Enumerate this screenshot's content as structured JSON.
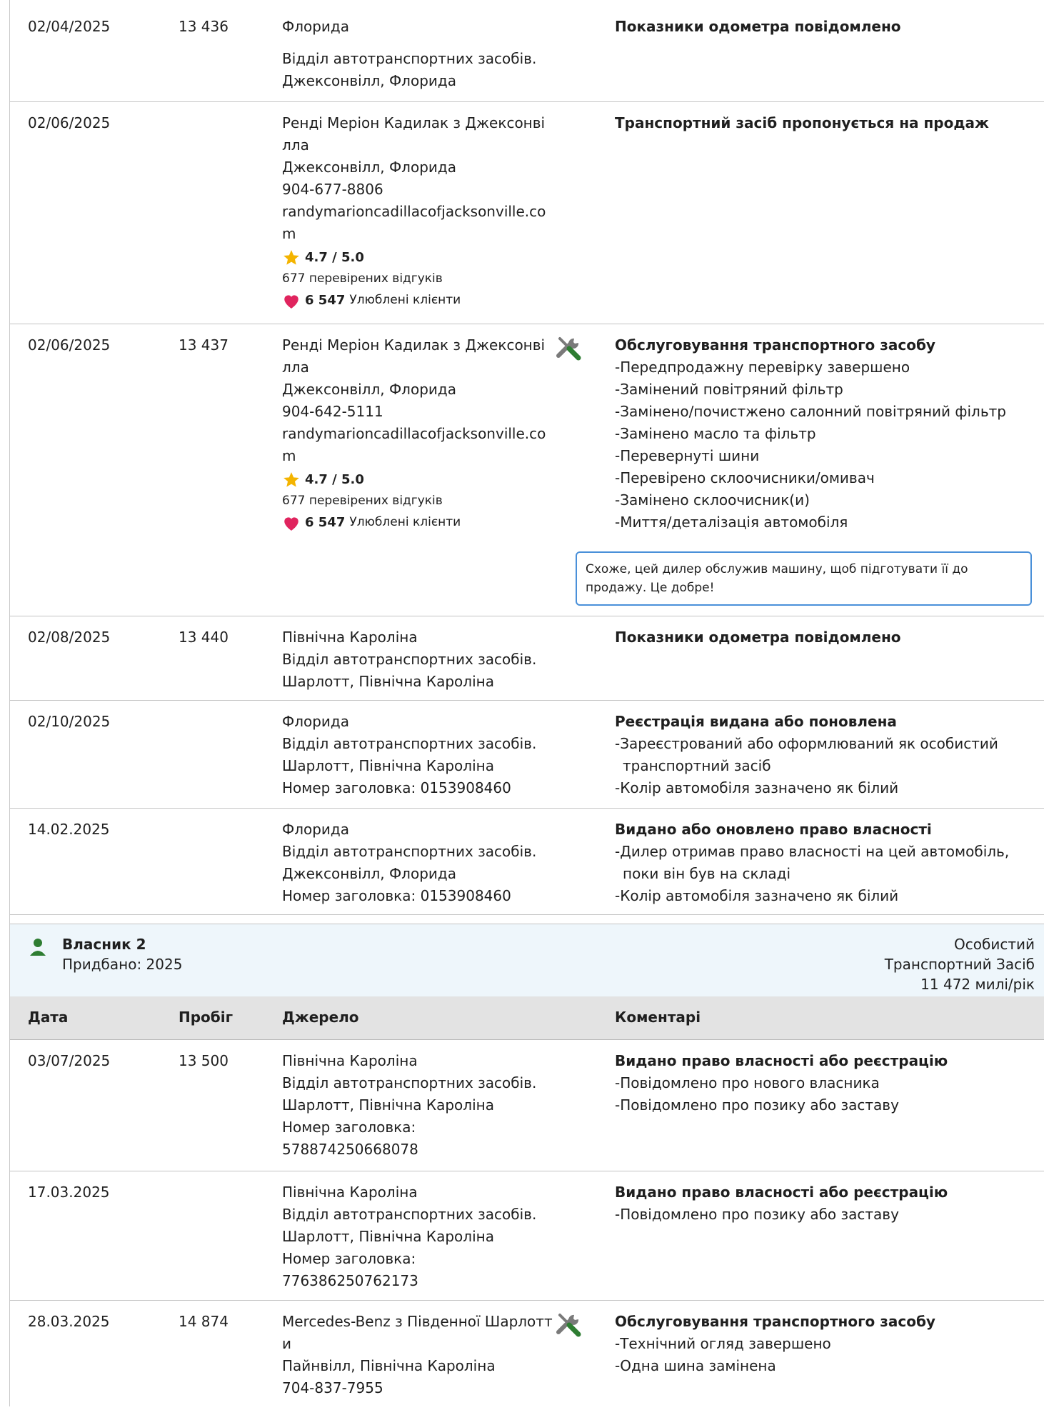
{
  "colors": {
    "accent_blue": "#4a90d9",
    "star": "#f4b400",
    "heart": "#e0245e",
    "wrench": "#2e7d32",
    "owner_bg": "#eef6fb",
    "header_bg": "#e3e3e3"
  },
  "owner1_rows": [
    {
      "date": "02/04/2025",
      "miles": "13 436",
      "source": [
        "Флорида",
        "Відділ автотранспортних засобів.",
        "Джексонвілл, Флорида"
      ],
      "comment_title": "Показники одометра повідомлено"
    },
    {
      "date": "02/06/2025",
      "miles": "",
      "source": [
        "Ренді Меріон Кадилак з Джексонвілла",
        "Джексонвілл, Флорида",
        "904-677-8806",
        "randymarioncadillacofjacksonville.com"
      ],
      "rating": "4.7 / 5.0",
      "reviews": "677 перевірених відгуків",
      "favorites_count": "6 547",
      "favorites_label": "Улюблені клієнти",
      "comment_title": "Транспортний засіб пропонується на продаж"
    },
    {
      "date": "02/06/2025",
      "miles": "13 437",
      "source": [
        "Ренді Меріон Кадилак з Джексонвілла",
        "Джексонвілл, Флорида",
        "904-642-5111",
        "randymarioncadillacofjacksonville.com"
      ],
      "rating": "4.7 / 5.0",
      "reviews": "677 перевірених відгуків",
      "favorites_count": "6 547",
      "favorites_label": "Улюблені клієнти",
      "icon": "wrench-screwdriver-icon",
      "comment_title": "Обслуговування транспортного засобу",
      "comment_items": [
        "-Передпродажну перевірку завершено",
        "-Замінений повітряний фільтр",
        "-Замінено/почистжено салонний повітряний фільтр",
        "-Замінено масло та фільтр",
        "-Перевернуті шини",
        "-Перевірено склоочисники/омивач",
        "-Замінено склоочисник(и)",
        "-Миття/деталізація автомобіля"
      ],
      "note": "Схоже, цей дилер обслужив машину, щоб підготувати її до продажу. Це добре!"
    },
    {
      "date": "02/08/2025",
      "miles": "13 440",
      "source": [
        "Північна Кароліна",
        "Відділ автотранспортних засобів.",
        "Шарлотт, Північна Кароліна"
      ],
      "comment_title": "Показники одометра повідомлено"
    },
    {
      "date": "02/10/2025",
      "miles": "",
      "source": [
        "Флорида",
        "Відділ автотранспортних засобів.",
        "Шарлотт, Північна Кароліна",
        "Номер заголовка: 0153908460"
      ],
      "comment_title": "Реєстрація видана або поновлена",
      "comment_items": [
        "-Зареєстрований або оформлюваний як особистий транспортний засіб",
        "-Колір автомобіля зазначено як білий"
      ]
    },
    {
      "date": "14.02.2025",
      "miles": "",
      "source": [
        "Флорида",
        "Відділ автотранспортних засобів.",
        "Джексонвілл, Флорида",
        "Номер заголовка: 0153908460"
      ],
      "comment_title": "Видано або оновлено право власності",
      "comment_items": [
        "-Дилер отримав право власності на цей автомобіль, поки він був на складі",
        "-Колір автомобіля зазначено як білий"
      ]
    }
  ],
  "owner2": {
    "name": "Власник 2",
    "acquired": "Придбано: 2025",
    "type_line1": "Особистий",
    "type_line2": "Транспортний Засіб",
    "mileage_rate": "11 472 милі/рік"
  },
  "table_headers": {
    "date": "Дата",
    "miles": "Пробіг",
    "source": "Джерело",
    "comments": "Коментарі"
  },
  "owner2_rows": [
    {
      "date": "03/07/2025",
      "miles": "13 500",
      "source": [
        "Північна Кароліна",
        "Відділ автотранспортних засобів.",
        "Шарлотт, Північна Кароліна",
        "Номер заголовка:",
        "578874250668078"
      ],
      "comment_title": "Видано право власності або реєстрацію",
      "comment_items": [
        "-Повідомлено про нового власника",
        "-Повідомлено про позику або заставу"
      ]
    },
    {
      "date": "17.03.2025",
      "miles": "",
      "source": [
        "Північна Кароліна",
        "Відділ автотранспортних засобів.",
        "Шарлотт, Північна Кароліна",
        "Номер заголовка:",
        "776386250762173"
      ],
      "comment_title": "Видано право власності або реєстрацію",
      "comment_items": [
        "-Повідомлено про позику або заставу"
      ]
    },
    {
      "date": "28.03.2025",
      "miles": "14 874",
      "source": [
        "Mercedes-Benz з Південної Шарлотти",
        "Пайнвілл, Північна Кароліна",
        "704-837-7955"
      ],
      "icon": "wrench-screwdriver-icon",
      "comment_title": "Обслуговування транспортного засобу",
      "comment_items": [
        "-Технічний огляд завершено",
        "-Одна шина замінена"
      ]
    }
  ]
}
